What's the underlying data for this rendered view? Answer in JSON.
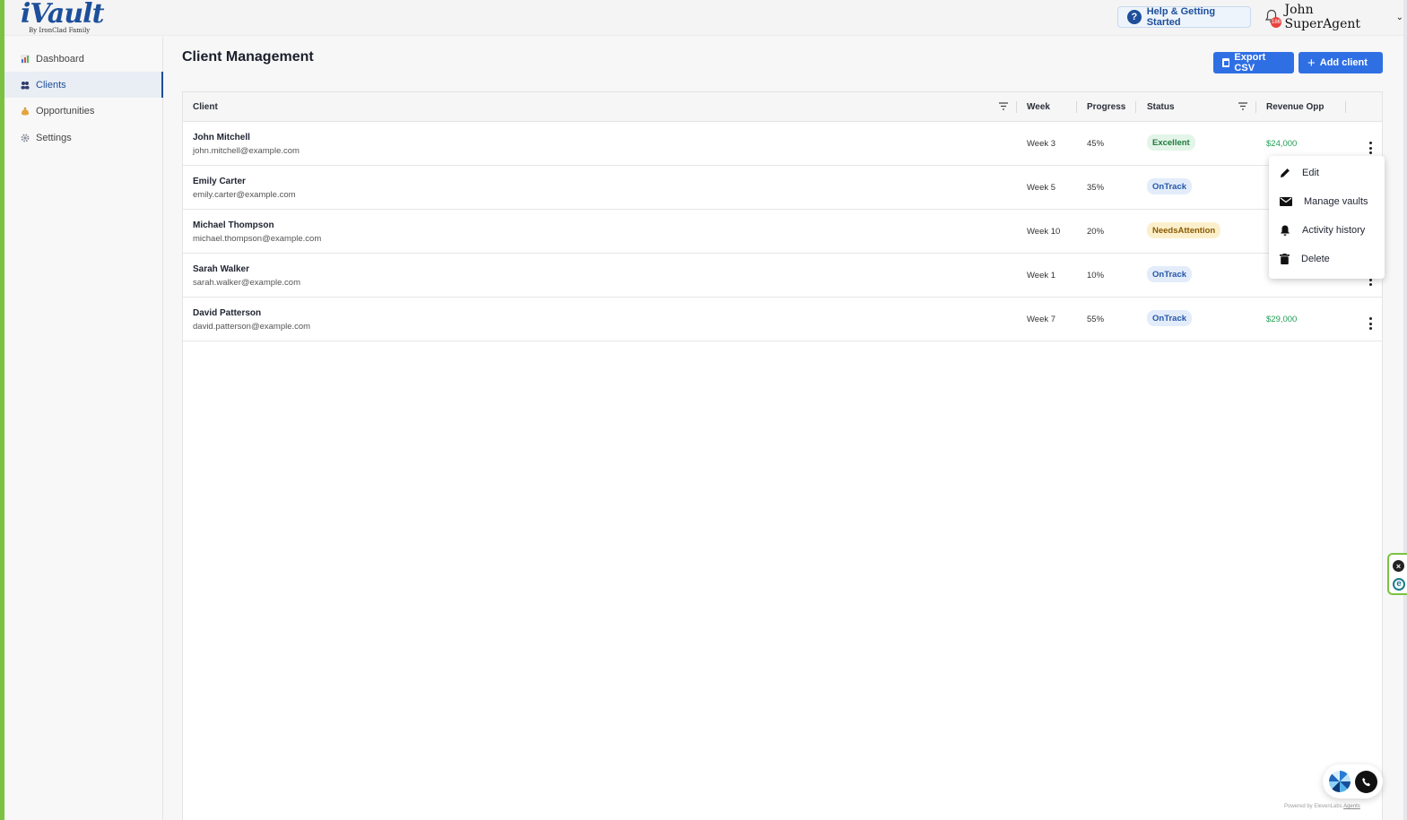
{
  "header": {
    "logo_text": "iVault",
    "logo_subtitle": "By IronClad Family",
    "help_label": "Help & Getting Started",
    "notification_count": "186",
    "user_name": "John SuperAgent"
  },
  "sidebar": {
    "items": [
      {
        "label": "Dashboard",
        "icon": "chart-icon",
        "active": false
      },
      {
        "label": "Clients",
        "icon": "users-icon",
        "active": true
      },
      {
        "label": "Opportunities",
        "icon": "money-bag-icon",
        "active": false
      },
      {
        "label": "Settings",
        "icon": "gear-icon",
        "active": false
      }
    ]
  },
  "main": {
    "title": "Client Management",
    "export_label": "Export CSV",
    "add_label": "Add client"
  },
  "table": {
    "columns": [
      "Client",
      "Week",
      "Progress",
      "Status",
      "Revenue Opp"
    ],
    "rows": [
      {
        "name": "John Mitchell",
        "email": "john.mitchell@example.com",
        "week": "Week 3",
        "progress": "45%",
        "status": "Excellent",
        "revenue": "$24,000"
      },
      {
        "name": "Emily Carter",
        "email": "emily.carter@example.com",
        "week": "Week 5",
        "progress": "35%",
        "status": "OnTrack",
        "revenue": ""
      },
      {
        "name": "Michael Thompson",
        "email": "michael.thompson@example.com",
        "week": "Week 10",
        "progress": "20%",
        "status": "NeedsAttention",
        "revenue": ""
      },
      {
        "name": "Sarah Walker",
        "email": "sarah.walker@example.com",
        "week": "Week 1",
        "progress": "10%",
        "status": "OnTrack",
        "revenue": ""
      },
      {
        "name": "David Patterson",
        "email": "david.patterson@example.com",
        "week": "Week 7",
        "progress": "55%",
        "status": "OnTrack",
        "revenue": "$29,000"
      }
    ]
  },
  "row_menu": {
    "items": [
      {
        "label": "Edit",
        "icon": "pencil-icon"
      },
      {
        "label": "Manage vaults",
        "icon": "envelope-icon"
      },
      {
        "label": "Activity history",
        "icon": "bell-icon"
      },
      {
        "label": "Delete",
        "icon": "trash-icon"
      }
    ]
  },
  "widgets": {
    "close_glyph": "×",
    "e_glyph": "e",
    "powered_by": "Powered by ElevenLabs",
    "powered_link": "Agents"
  },
  "colors": {
    "accent": "#2f6fe4",
    "brand": "#1d4f9a",
    "side_accent": "#7cc242",
    "revenue": "#1e9e54"
  }
}
